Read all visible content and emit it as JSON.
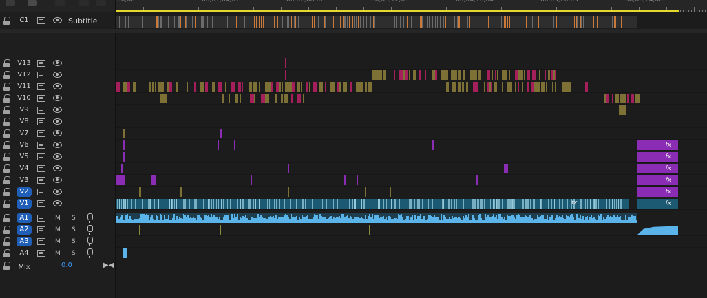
{
  "ruler": {
    "timecodes": [
      "00;00",
      "00;01;04;01",
      "00;02;08;02",
      "00;03;12;03",
      "00;04;16;04",
      "00;05;20;05",
      "00;06;24;06"
    ]
  },
  "colors": {
    "accent": "#1f5fb8",
    "workarea": "#e4d82a",
    "video_main": "#1c5a73",
    "olive": "#7d7135",
    "magenta": "#a51f5a",
    "purple": "#8a2cb4",
    "audio": "#5ab4ea"
  },
  "subtitle_track": {
    "name": "C1",
    "label": "Subtitle"
  },
  "video_tracks": [
    {
      "name": "V13",
      "targeted": false
    },
    {
      "name": "V12",
      "targeted": false
    },
    {
      "name": "V11",
      "targeted": false
    },
    {
      "name": "V10",
      "targeted": false
    },
    {
      "name": "V9",
      "targeted": false
    },
    {
      "name": "V8",
      "targeted": false
    },
    {
      "name": "V7",
      "targeted": false
    },
    {
      "name": "V6",
      "targeted": false
    },
    {
      "name": "V5",
      "targeted": false
    },
    {
      "name": "V4",
      "targeted": false
    },
    {
      "name": "V3",
      "targeted": false
    },
    {
      "name": "V2",
      "targeted": true
    },
    {
      "name": "V1",
      "targeted": true
    }
  ],
  "audio_tracks": [
    {
      "name": "A1",
      "targeted": true,
      "mute": "M",
      "solo": "S"
    },
    {
      "name": "A2",
      "targeted": true,
      "mute": "M",
      "solo": "S"
    },
    {
      "name": "A3",
      "targeted": true,
      "mute": "M",
      "solo": "S"
    },
    {
      "name": "A4",
      "targeted": false,
      "mute": "M",
      "solo": "S"
    }
  ],
  "mix": {
    "label": "Mix",
    "value": "0.0"
  },
  "fx_badge": "fx"
}
